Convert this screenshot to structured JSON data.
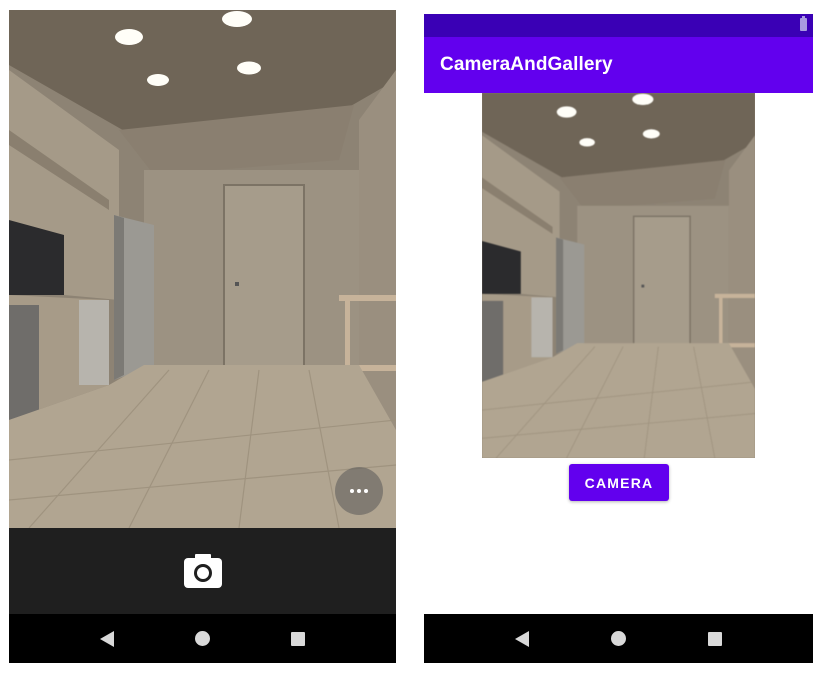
{
  "left_phone": {
    "more_options_icon": "more-horiz-icon",
    "shutter_icon": "camera-icon",
    "nav": {
      "back_icon": "back-triangle-icon",
      "home_icon": "home-circle-icon",
      "recent_icon": "recents-square-icon"
    }
  },
  "right_phone": {
    "app_title": "CameraAndGallery",
    "camera_button_label": "CAMERA",
    "colors": {
      "primary": "#6200ee",
      "primary_dark": "#3a00b5"
    },
    "nav": {
      "back_icon": "back-triangle-icon",
      "home_icon": "home-circle-icon",
      "recent_icon": "recents-square-icon"
    }
  }
}
